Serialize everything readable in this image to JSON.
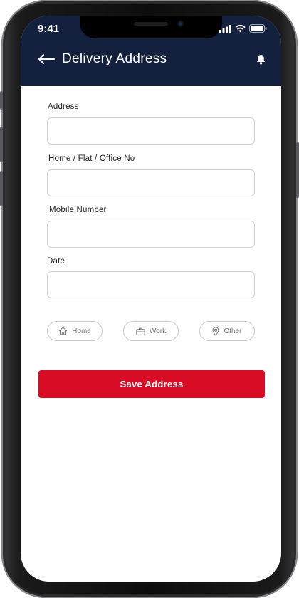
{
  "status_bar": {
    "time": "9:41"
  },
  "header": {
    "title": "Delivery Address"
  },
  "form": {
    "fields": [
      {
        "label": "Address",
        "value": ""
      },
      {
        "label": "Home / Flat / Office No",
        "value": ""
      },
      {
        "label": "Mobile Number",
        "value": ""
      },
      {
        "label": "Date",
        "value": ""
      }
    ]
  },
  "address_types": [
    {
      "label": "Home",
      "icon": "home-icon"
    },
    {
      "label": "Work",
      "icon": "briefcase-icon"
    },
    {
      "label": "Other",
      "icon": "location-pin-icon"
    }
  ],
  "save_button": {
    "label": "Save Address"
  },
  "colors": {
    "header_bg": "#13213e",
    "accent": "#d80c24"
  }
}
